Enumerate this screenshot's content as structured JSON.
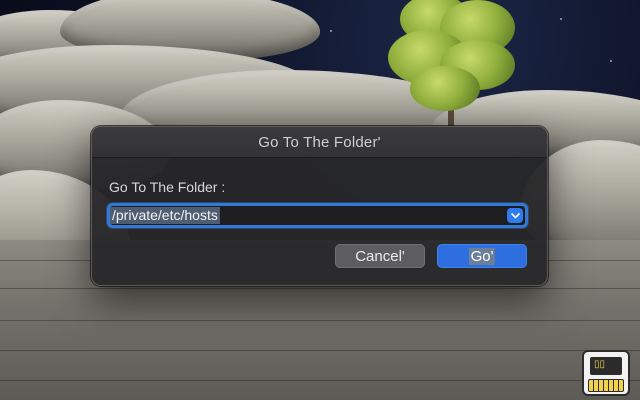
{
  "dialog": {
    "title": "Go To The Folder'",
    "field_label": "Go To The Folder :",
    "path_value": "/private/etc/hosts",
    "cancel_label": "Cancel'",
    "go_label": "Go'"
  },
  "colors": {
    "accent": "#2d6fde",
    "focus_ring": "#3478d6",
    "dialog_bg": "#28282a"
  },
  "icons": {
    "dropdown": "chevron-down-icon",
    "badge": "computer-keyboard-icon"
  }
}
